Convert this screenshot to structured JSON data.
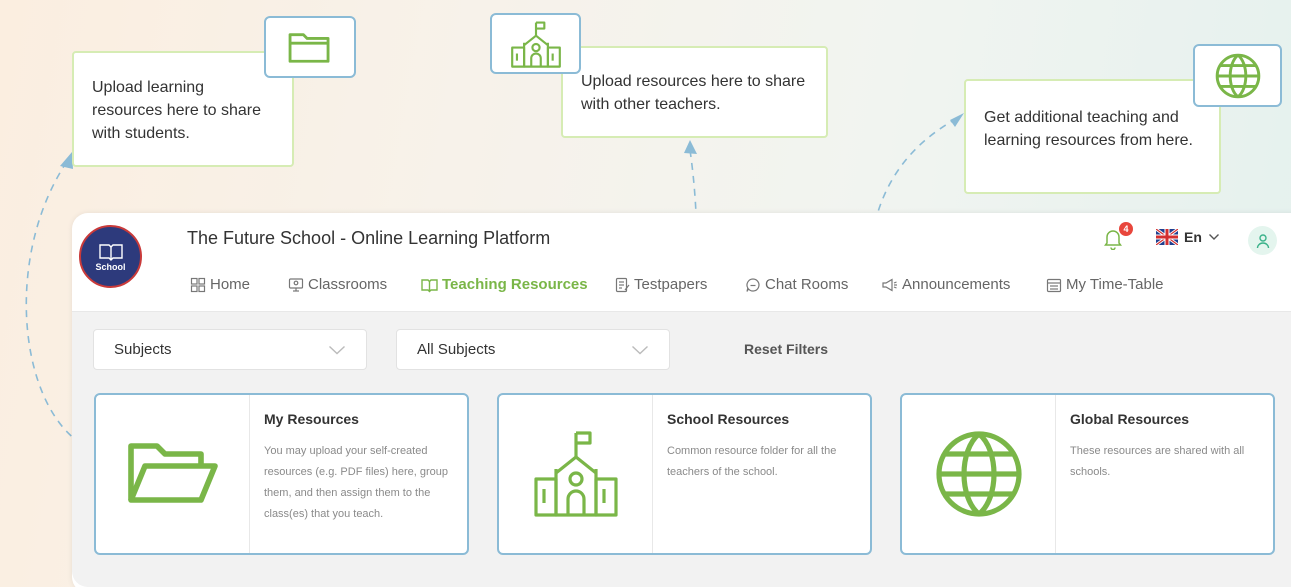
{
  "callouts": {
    "my_resources": "Upload learning resources here to share with students.",
    "school_resources": "Upload resources here to share with other teachers.",
    "global_resources": "Get additional teaching and learning resources from here."
  },
  "header": {
    "logo_text": "School",
    "title": "The Future School - Online Learning Platform",
    "notification_count": "4",
    "language": "En"
  },
  "nav": {
    "home": "Home",
    "classrooms": "Classrooms",
    "teaching_resources": "Teaching Resources",
    "testpapers": "Testpapers",
    "chat_rooms": "Chat Rooms",
    "announcements": "Announcements",
    "timetable": "My Time-Table",
    "active": "teaching_resources"
  },
  "filters": {
    "subjects": "Subjects",
    "all_subjects": "All Subjects",
    "reset": "Reset Filters"
  },
  "cards": {
    "my": {
      "title": "My Resources",
      "desc": "You may upload your self-created resources (e.g. PDF files) here, group them, and then assign them to the class(es) that you teach."
    },
    "school": {
      "title": "School Resources",
      "desc": "Common resource folder for all the teachers of the school."
    },
    "global": {
      "title": "Global Resources",
      "desc": "These resources are shared with all schools."
    }
  },
  "colors": {
    "accent_green": "#7ab648",
    "card_border": "#8bbbd6",
    "dash": "#8bbbd6",
    "badge": "#e8463c"
  },
  "icons": [
    "folder-icon",
    "school-icon",
    "globe-icon",
    "bell-icon",
    "uk-flag-icon",
    "chevron-down-icon",
    "user-icon",
    "home-icon",
    "classroom-icon",
    "book-icon",
    "testpaper-icon",
    "chat-icon",
    "megaphone-icon",
    "calendar-icon"
  ]
}
